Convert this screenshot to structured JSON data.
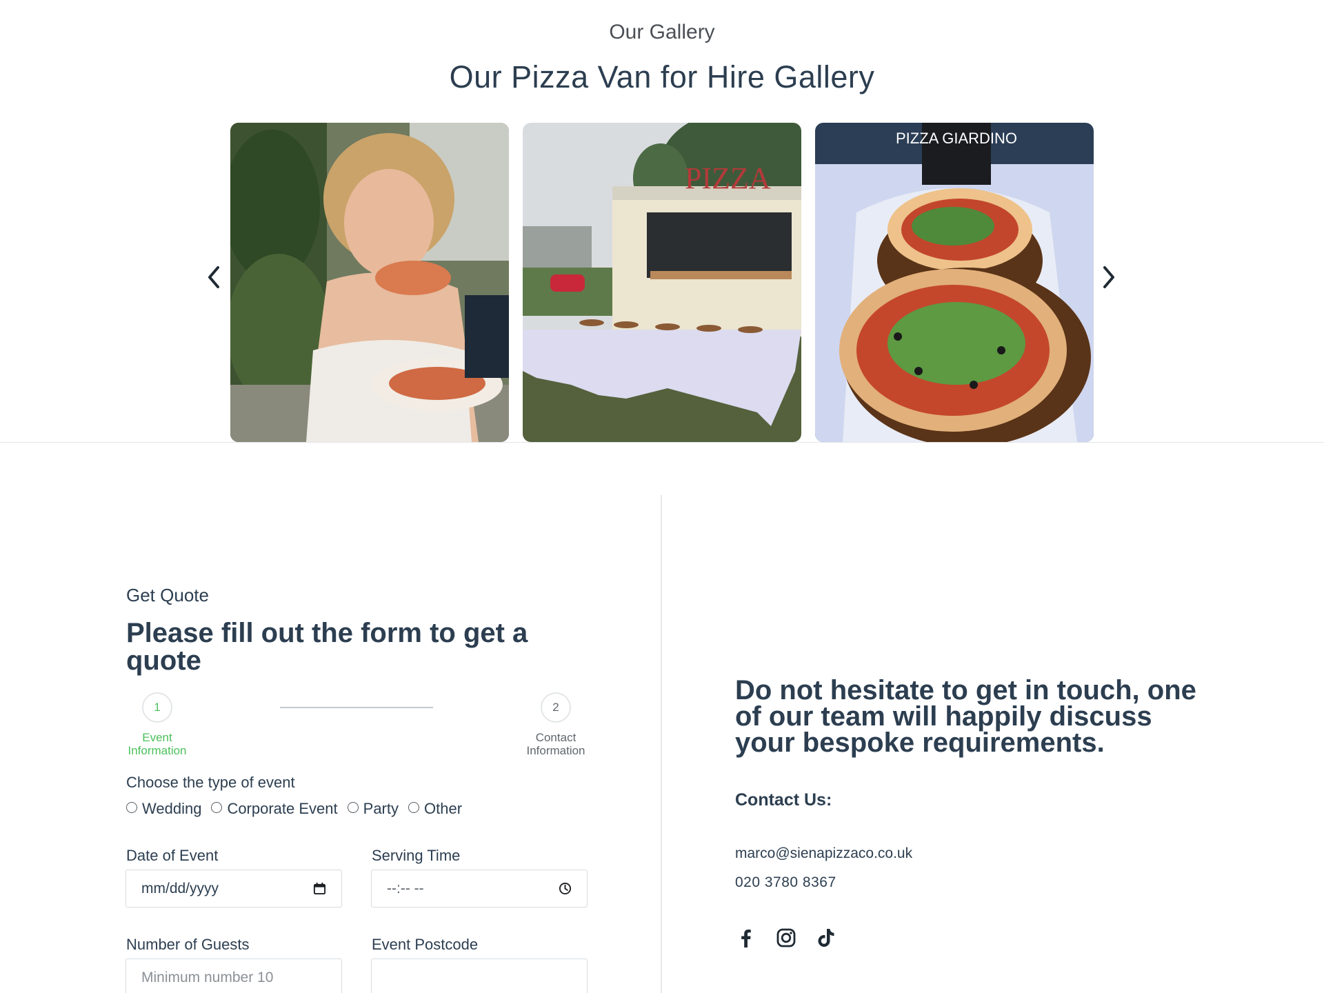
{
  "gallery": {
    "eyebrow": "Our Gallery",
    "title": "Our Pizza Van for Hire Gallery",
    "prev_icon": "chevron-left-icon",
    "next_icon": "chevron-right-icon",
    "slides": [
      {
        "name": "bride-eating-pizza-photo"
      },
      {
        "name": "pizza-van-at-event-photo",
        "sign_text": "PIZZA"
      },
      {
        "name": "pizzas-on-boards-photo",
        "sign_text": "PIZZA GIARDINO"
      }
    ]
  },
  "quote_form": {
    "eyebrow": "Get Quote",
    "title": "Please fill out the form to get a quote",
    "steps": [
      {
        "number": "1",
        "label": "Event Information",
        "active": true
      },
      {
        "number": "2",
        "label": "Contact Information",
        "active": false
      }
    ],
    "event_type": {
      "label": "Choose the type of event",
      "options": [
        "Wedding",
        "Corporate Event",
        "Party",
        "Other"
      ]
    },
    "date_field": {
      "label": "Date of Event",
      "value": "mm/dd/yyyy",
      "icon": "calendar-icon"
    },
    "time_field": {
      "label": "Serving Time",
      "value": "--:-- --",
      "icon": "clock-icon"
    },
    "guests_field": {
      "label": "Number of Guests",
      "placeholder": "Minimum number 10"
    },
    "postcode_field": {
      "label": "Event Postcode",
      "placeholder": ""
    }
  },
  "contact": {
    "heading": "Do not hesitate to get in touch, one of our team will happily discuss your bespoke requirements.",
    "label": "Contact Us:",
    "email": "marco@sienapizzaco.co.uk",
    "phone": "020 3780 8367",
    "socials": [
      "facebook-icon",
      "instagram-icon",
      "tiktok-icon"
    ]
  },
  "colors": {
    "heading": "#2c3e50",
    "accent_green": "#4cc05c",
    "border": "#d7dbdf"
  }
}
